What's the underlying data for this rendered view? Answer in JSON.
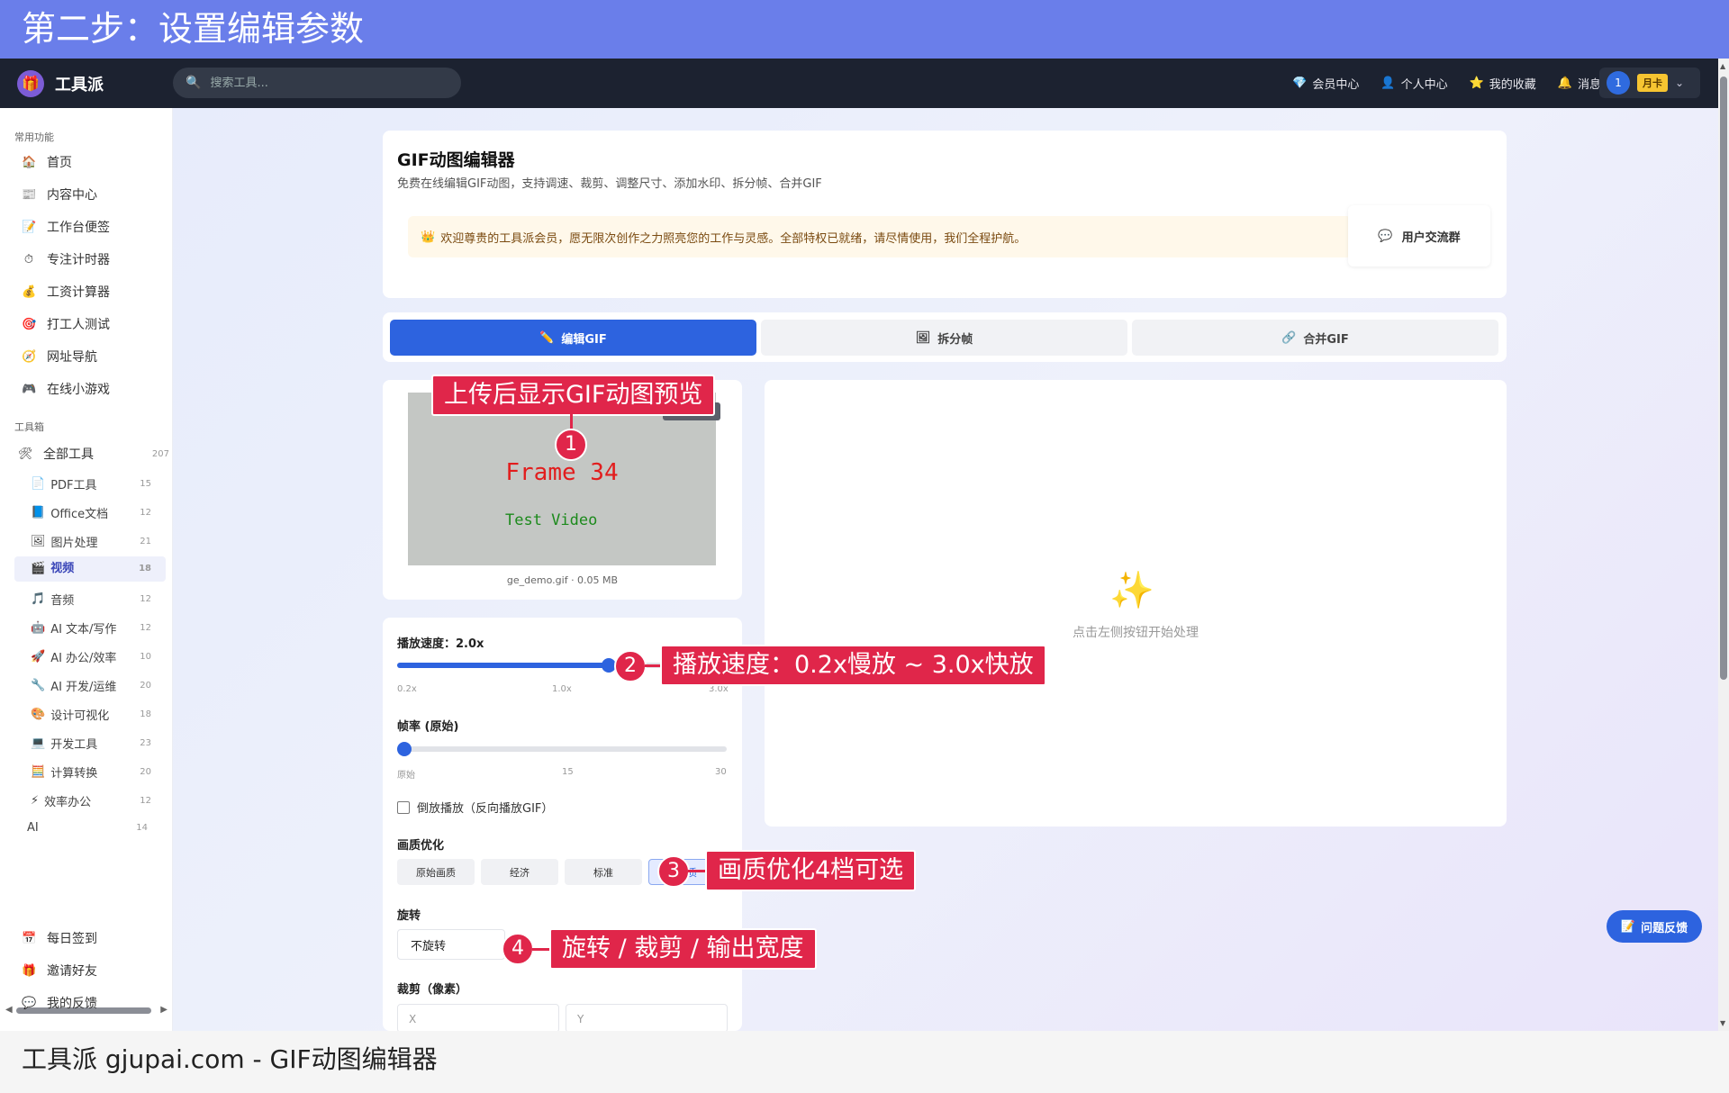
{
  "banner": {
    "text": "第二步：设置编辑参数"
  },
  "navbar": {
    "logo_icon": "🎁",
    "logo_text": "工具派",
    "search_placeholder": "搜索工具...",
    "links": [
      {
        "icon": "💎",
        "label": "会员中心"
      },
      {
        "icon": "👤",
        "label": "个人中心"
      },
      {
        "icon": "⭐",
        "label": "我的收藏"
      },
      {
        "icon": "🔔",
        "label": "消息"
      }
    ],
    "user": {
      "avatar": "1",
      "badge": "月卡"
    }
  },
  "sidebar": {
    "common_title": "常用功能",
    "common_items": [
      {
        "icon": "🏠",
        "label": "首页"
      },
      {
        "icon": "📰",
        "label": "内容中心"
      },
      {
        "icon": "📝",
        "label": "工作台便签"
      },
      {
        "icon": "⏱",
        "label": "专注计时器"
      },
      {
        "icon": "💰",
        "label": "工资计算器"
      },
      {
        "icon": "🎯",
        "label": "打工人测试"
      },
      {
        "icon": "🧭",
        "label": "网址导航"
      },
      {
        "icon": "🎮",
        "label": "在线小游戏"
      }
    ],
    "toolbox_title": "工具箱",
    "all_tools": {
      "icon": "🛠",
      "label": "全部工具",
      "count": "207"
    },
    "categories": [
      {
        "icon": "📄",
        "label": "PDF工具",
        "count": "15"
      },
      {
        "icon": "📘",
        "label": "Office文档",
        "count": "12"
      },
      {
        "icon": "🖼",
        "label": "图片处理",
        "count": "21"
      },
      {
        "icon": "🎬",
        "label": "视频",
        "count": "18"
      },
      {
        "icon": "🎵",
        "label": "音频",
        "count": "12"
      },
      {
        "icon": "🤖",
        "label": "AI 文本/写作",
        "count": "12"
      },
      {
        "icon": "🚀",
        "label": "AI 办公/效率",
        "count": "10"
      },
      {
        "icon": "🔧",
        "label": "AI 开发/运维",
        "count": "20"
      },
      {
        "icon": "🎨",
        "label": "设计可视化",
        "count": "18"
      },
      {
        "icon": "💻",
        "label": "开发工具",
        "count": "23"
      },
      {
        "icon": "🧮",
        "label": "计算转换",
        "count": "20"
      },
      {
        "icon": "⚡",
        "label": "效率办公",
        "count": "12"
      },
      {
        "icon": "",
        "label": "AI",
        "count": "14"
      }
    ],
    "active_category_index": 3,
    "bottom_items": [
      {
        "icon": "📅",
        "label": "每日签到"
      },
      {
        "icon": "🎁",
        "label": "邀请好友"
      },
      {
        "icon": "💬",
        "label": "我的反馈"
      }
    ]
  },
  "header_card": {
    "title": "GIF动图编辑器",
    "subtitle": "免费在线编辑GIF动图，支持调速、裁剪、调整尺寸、添加水印、拆分帧、合并GIF",
    "welcome_icon": "👑",
    "welcome": "欢迎尊贵的工具派会员，愿无限次创作之力照亮您的工作与灵感。全部特权已就绪，请尽情使用，我们全程护航。",
    "group_icon": "💬",
    "group_label": "用户交流群"
  },
  "tabs": [
    {
      "icon": "✏️",
      "label": "编辑GIF",
      "active": true
    },
    {
      "icon": "🖼",
      "label": "拆分帧",
      "active": false
    },
    {
      "icon": "🔗",
      "label": "合并GIF",
      "active": false
    }
  ],
  "preview": {
    "frame_text": "Frame 34",
    "test_text": "Test Video",
    "replace_label": "重新选择",
    "file_info": "ge_demo.gif · 0.05 MB"
  },
  "result": {
    "icon": "✨",
    "hint": "点击左侧按钮开始处理"
  },
  "settings": {
    "speed_label": "播放速度：2.0x",
    "speed": {
      "min": 0.2,
      "max": 3.0,
      "value": 2.0
    },
    "speed_ticks": [
      "0.2x",
      "1.0x",
      "3.0x"
    ],
    "fps_label": "帧率 (原始)",
    "fps": {
      "min": 0,
      "max": 30,
      "value": 0
    },
    "fps_ticks": [
      "原始",
      "15",
      "30"
    ],
    "reverse_label": "倒放播放（反向播放GIF）",
    "quality_title": "画质优化",
    "quality_options": [
      "原始画质",
      "经济",
      "标准",
      "高质"
    ],
    "rotate_title": "旋转",
    "rotate_value": "不旋转",
    "crop_title": "裁剪（像素）",
    "crop_x_placeholder": "X",
    "crop_y_placeholder": "Y"
  },
  "annotations": [
    {
      "num": "1",
      "text": "上传后显示GIF动图预览"
    },
    {
      "num": "2",
      "text": "播放速度：0.2x慢放 ~ 3.0x快放"
    },
    {
      "num": "3",
      "text": "画质优化4档可选"
    },
    {
      "num": "4",
      "text": "旋转 / 裁剪 / 输出宽度"
    }
  ],
  "feedback": {
    "icon": "📝",
    "label": "问题反馈"
  },
  "footer": {
    "text": "工具派 gjupai.com - GIF动图编辑器"
  },
  "colors": {
    "primary": "#2d63df",
    "banner": "#6a7eea",
    "annotation": "#e0264a",
    "nav": "#1c2230"
  }
}
